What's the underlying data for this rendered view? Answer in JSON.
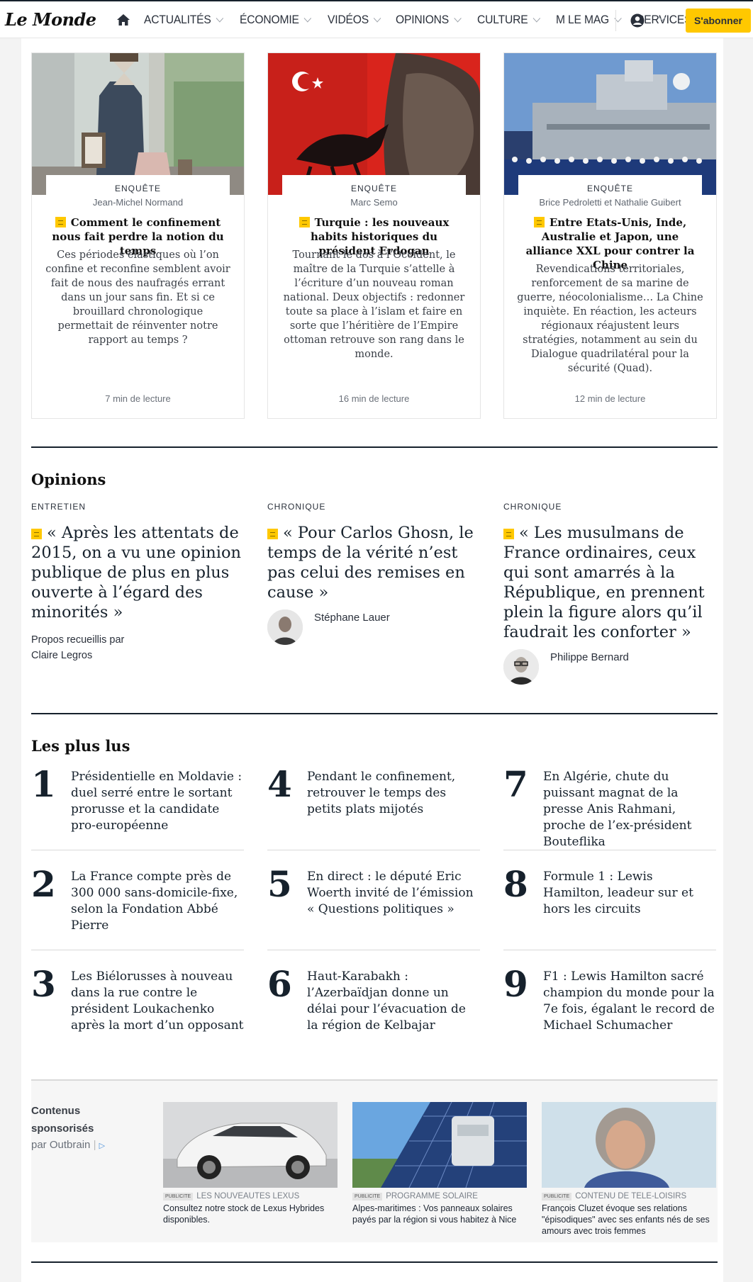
{
  "nav": {
    "logo": "Le Monde",
    "items": [
      {
        "label": "ACTUALITÉS"
      },
      {
        "label": "ÉCONOMIE"
      },
      {
        "label": "VIDÉOS"
      },
      {
        "label": "OPINIONS"
      },
      {
        "label": "CULTURE"
      },
      {
        "label": "M LE MAG"
      },
      {
        "label": "SERVICES"
      }
    ],
    "subscribe": "S'abonner"
  },
  "cards": [
    {
      "kicker": "ENQUÊTE",
      "author": "Jean-Michel Normand",
      "title": "Comment le confinement nous fait perdre la notion du temps",
      "desc": "Ces périodes élastiques où l’on confine et reconfine semblent avoir fait de nous des naufragés errant dans un jour sans fin. Et si ce brouillard chronologique permettait de réinventer notre rapport au temps ?",
      "read": "7 min de lecture"
    },
    {
      "kicker": "ENQUÊTE",
      "author": "Marc Semo",
      "title": "Turquie : les nouveaux habits historiques du président Erdogan",
      "desc": "Tournant le dos à l’Occident, le maître de la Turquie s’attelle à l’écriture d’un nouveau roman national. Deux objectifs : redonner toute sa place à l’islam et faire en sorte que l’héritière de l’Empire ottoman retrouve son rang dans le monde.",
      "read": "16 min de lecture"
    },
    {
      "kicker": "ENQUÊTE",
      "author": "Brice Pedroletti et Nathalie Guibert",
      "title": "Entre Etats-Unis, Inde, Australie et Japon, une alliance XXL pour contrer la Chine",
      "desc": "Revendications territoriales, renforcement de sa marine de guerre, néocolonialisme… La Chine inquiète. En réaction, les acteurs régionaux réajustent leurs stratégies, notamment au sein du Dialogue quadrilatéral pour la sécurité (Quad).",
      "read": "12 min de lecture"
    }
  ],
  "opinions": {
    "title": "Opinions",
    "items": [
      {
        "kind": "ENTRETIEN",
        "quote": "« Après les attentats de 2015, on a vu une opinion publique de plus en plus ouverte à l’égard des minorités »",
        "by1": "Propos recueillis par",
        "by2": "Claire Legros"
      },
      {
        "kind": "CHRONIQUE",
        "quote": "« Pour Carlos Ghosn, le temps de la vérité n’est pas celui des remises en cause »",
        "person": "Stéphane Lauer"
      },
      {
        "kind": "CHRONIQUE",
        "quote": "« Les musulmans de France ordinaires, ceux qui sont amarrés à la République, en prennent plein la figure alors qu’il faudrait les conforter »",
        "person": "Philippe Bernard"
      }
    ]
  },
  "most_read": {
    "title": "Les plus lus",
    "items": [
      {
        "num": "1",
        "text": "Présidentielle en Moldavie : duel serré entre le sortant prorusse et la candidate pro-européenne"
      },
      {
        "num": "2",
        "text": "La France compte près de 300 000 sans-domicile-fixe, selon la Fondation Abbé Pierre"
      },
      {
        "num": "3",
        "text": "Les Biélorusses à nouveau dans la rue contre le président Loukachenko après la mort d’un opposant"
      },
      {
        "num": "4",
        "text": "Pendant le confinement, retrouver le temps des petits plats mijotés"
      },
      {
        "num": "5",
        "text": "En direct : le député Eric Woerth invité de l’émission « Questions politiques »"
      },
      {
        "num": "6",
        "text": "Haut-Karabakh : l’Azerbaïdjan donne un délai pour l’évacuation de la région de Kelbajar"
      },
      {
        "num": "7",
        "text": "En Algérie, chute du puissant magnat de la presse Anis Rahmani, proche de l’ex-président Bouteflika"
      },
      {
        "num": "8",
        "text": "Formule 1 : Lewis Hamilton, leadeur sur et hors les circuits"
      },
      {
        "num": "9",
        "text": "F1 : Lewis Hamilton sacré champion du monde pour la 7e fois, égalant le record de Michael Schumacher"
      }
    ]
  },
  "sponsored": {
    "label1": "Contenus",
    "label2": "sponsorisés",
    "by": "par Outbrain",
    "pub": "PUBLICITE",
    "items": [
      {
        "source": "LES NOUVEAUTES LEXUS",
        "title": "Consultez notre stock de Lexus Hybrides disponibles."
      },
      {
        "source": "PROGRAMME SOLAIRE",
        "title": "Alpes-maritimes : Vos panneaux solaires payés par la région si vous habitez à Nice"
      },
      {
        "source": "CONTENU DE TELE-LOISIRS",
        "title": "François Cluzet évoque ses relations \"épisodiques\" avec ses enfants nés de ses amours avec trois femmes"
      }
    ]
  },
  "colors": {
    "accent": "#ffc800",
    "ink": "#16212c"
  }
}
